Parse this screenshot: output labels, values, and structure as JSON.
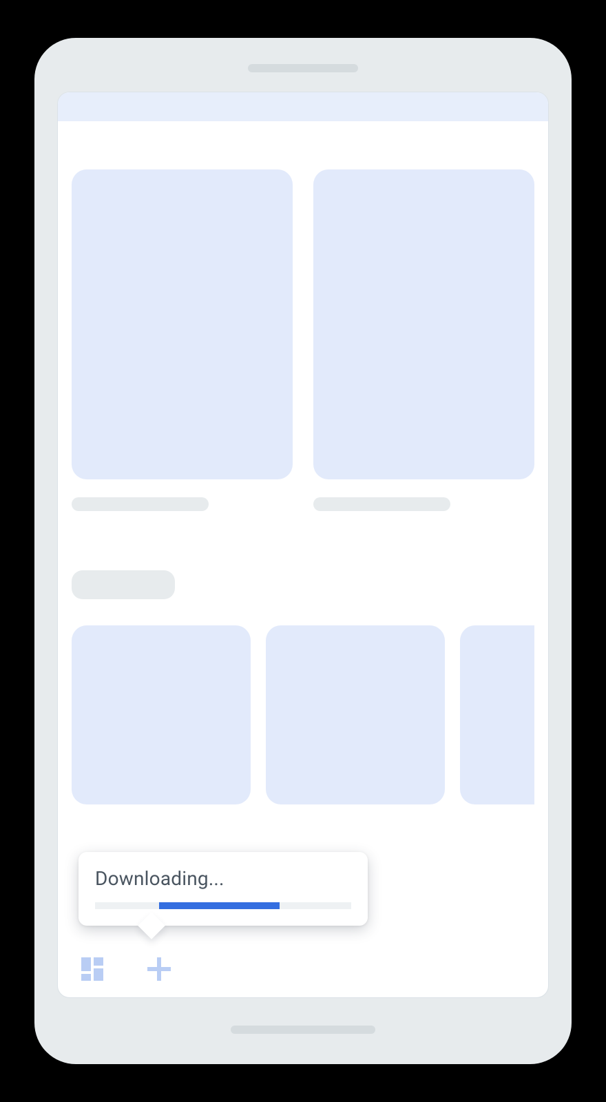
{
  "tooltip": {
    "title": "Downloading...",
    "progress_start_pct": 25,
    "progress_end_pct": 72
  },
  "nav": {
    "dashboard_label": "dashboard",
    "add_label": "add"
  },
  "colors": {
    "accent": "#346ee0",
    "placeholder": "#e2eafb"
  }
}
